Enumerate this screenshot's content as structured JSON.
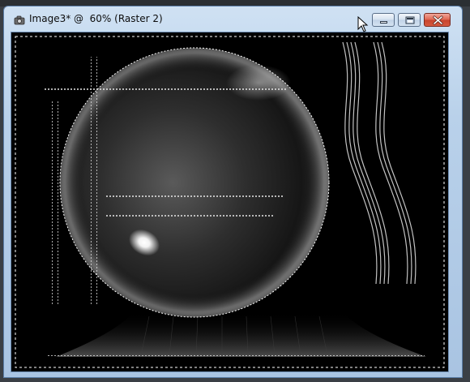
{
  "background": {
    "tab_fragment": "..."
  },
  "window": {
    "title": "Image3* @  60% (Raster 2)",
    "app_icon": "camera-icon",
    "controls": {
      "minimize_icon": "minimize-icon",
      "maximize_icon": "maximize-icon",
      "close_icon": "close-icon"
    }
  },
  "canvas": {
    "layer": "Raster 2",
    "zoom": "60%",
    "has_selection": true
  },
  "colors": {
    "title_bar": "#b9d1ea",
    "close_red": "#c8452e",
    "canvas_bg": "#000000"
  }
}
